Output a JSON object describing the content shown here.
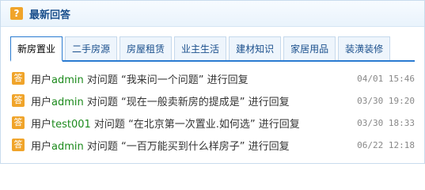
{
  "panel": {
    "title": "最新回答",
    "title_icon": "question-icon"
  },
  "tabs": [
    {
      "label": "新房置业",
      "active": true
    },
    {
      "label": "二手房源",
      "active": false
    },
    {
      "label": "房屋租赁",
      "active": false
    },
    {
      "label": "业主生活",
      "active": false
    },
    {
      "label": "建材知识",
      "active": false
    },
    {
      "label": "家居用品",
      "active": false
    },
    {
      "label": "装潢装修",
      "active": false
    }
  ],
  "items": [
    {
      "user_prefix": "用户",
      "user": "admin",
      "mid": " 对问题 ",
      "question": "“我来问一个问题”",
      "suffix": " 进行回复",
      "time": "04/01 15:46",
      "icon_label": "答"
    },
    {
      "user_prefix": "用户",
      "user": "admin",
      "mid": " 对问题 ",
      "question": "“现在一般卖新房的提成是”",
      "suffix": " 进行回复",
      "time": "03/30 19:20",
      "icon_label": "答"
    },
    {
      "user_prefix": "用户",
      "user": "test001",
      "mid": " 对问题 ",
      "question": "“在北京第一次置业.如何选”",
      "suffix": " 进行回复",
      "time": "03/30 18:33",
      "icon_label": "答"
    },
    {
      "user_prefix": "用户",
      "user": "admin",
      "mid": " 对问题 ",
      "question": "“一百万能买到什么样房子”",
      "suffix": " 进行回复",
      "time": "06/22 12:18",
      "icon_label": "答"
    }
  ],
  "colors": {
    "accent": "#2a7bd1",
    "title": "#1a4f8c",
    "user": "#1c8a1c",
    "icon": "#f0a42a"
  }
}
